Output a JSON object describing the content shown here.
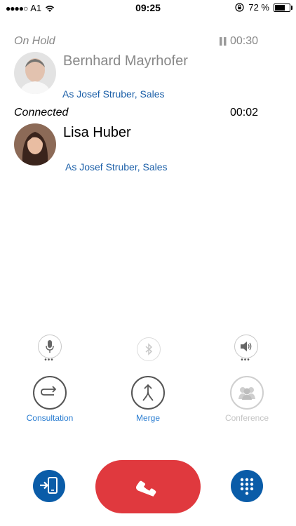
{
  "status_bar": {
    "carrier": "A1",
    "time": "09:25",
    "battery": "72 %",
    "battery_level": 0.72
  },
  "calls": [
    {
      "state": "On Hold",
      "timer": "00:30",
      "name": "Bernhard Mayrhofer",
      "as_line": "As Josef Struber, Sales"
    },
    {
      "state": "Connected",
      "timer": "00:02",
      "name": "Lisa Huber",
      "as_line": "As Josef Struber, Sales"
    }
  ],
  "controls": {
    "consultation": "Consultation",
    "merge": "Merge",
    "conference": "Conference"
  },
  "colors": {
    "accent_blue": "#0a5ca8",
    "link_blue": "#1b5fa8",
    "label_blue": "#2a7dd1",
    "end_call_red": "#e0393e",
    "disabled_gray": "#c8c8c8"
  }
}
